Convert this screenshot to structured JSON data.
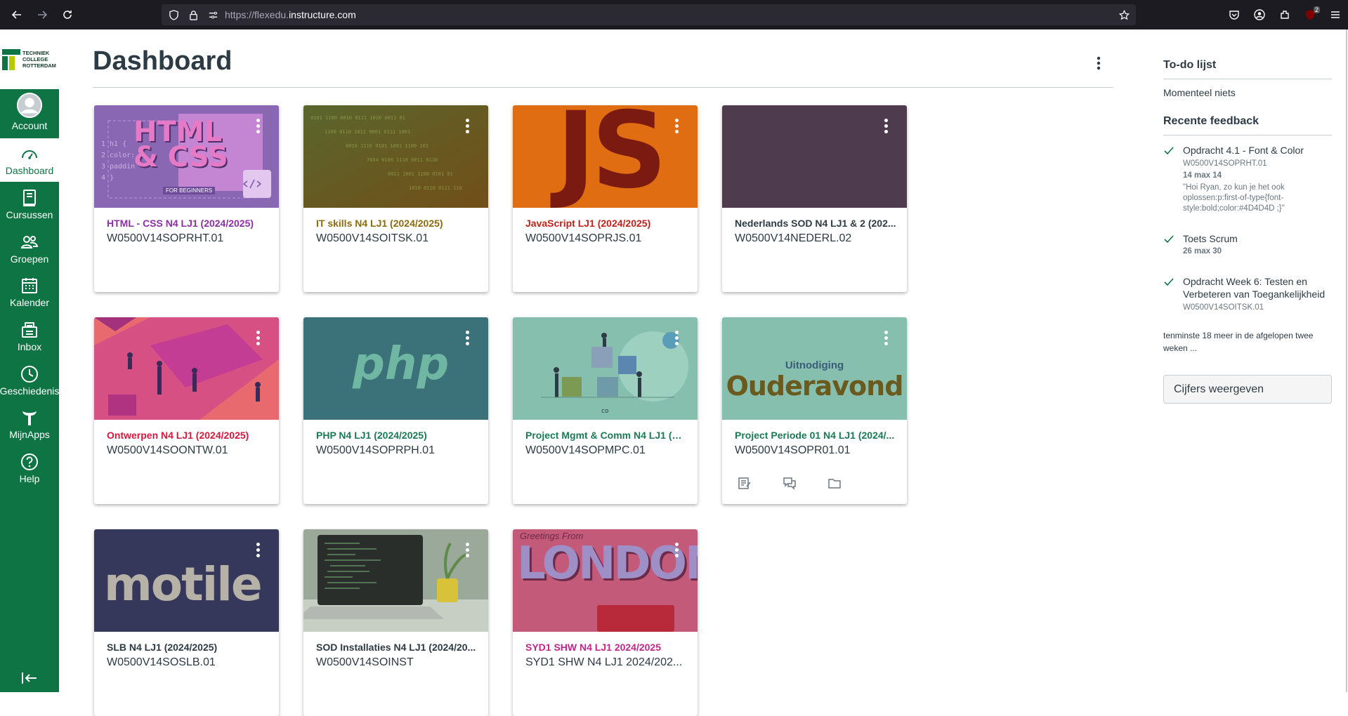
{
  "browser": {
    "url_prefix": "https://flexedu.",
    "url_domain": "instructure.com",
    "ublock_badge": "2"
  },
  "global_nav": {
    "logo_lines": [
      "TECHNIEK",
      "COLLEGE",
      "ROTTERDAM"
    ],
    "items": [
      {
        "label": "Account",
        "icon": "avatar-icon"
      },
      {
        "label": "Dashboard",
        "icon": "dashboard-icon"
      },
      {
        "label": "Cursussen",
        "icon": "courses-icon"
      },
      {
        "label": "Groepen",
        "icon": "groups-icon"
      },
      {
        "label": "Kalender",
        "icon": "calendar-icon"
      },
      {
        "label": "Inbox",
        "icon": "inbox-icon"
      },
      {
        "label": "Geschiedenis",
        "icon": "history-icon"
      },
      {
        "label": "MijnApps",
        "icon": "apps-icon"
      },
      {
        "label": "Help",
        "icon": "help-icon"
      }
    ],
    "active_color": "#0f7443"
  },
  "main": {
    "title": "Dashboard"
  },
  "cards": [
    {
      "name": "HTML - CSS N4 LJ1 (2024/2025)",
      "code": "W0500V14SOPRHT.01",
      "color": "#8b2fa3",
      "hero_text_big": "HTML\n& CSS",
      "hero_text_small": "FOR BEGINNERS"
    },
    {
      "name": "IT skills N4 LJ1 (2024/2025)",
      "code": "W0500V14SOITSK.01",
      "color": "#8b6b10"
    },
    {
      "name": "JavaScript LJ1 (2024/2025)",
      "code": "W0500V14SOPRJS.01",
      "color": "#c0221b",
      "hero_text_big": "JS"
    },
    {
      "name": "Nederlands SOD N4 LJ1 & 2 (202...",
      "code": "W0500V14NEDERL.02",
      "color": "#2d3b45"
    },
    {
      "name": "Ontwerpen N4 LJ1 (2024/2025)",
      "code": "W0500V14SOONTW.01",
      "color": "#d4183d"
    },
    {
      "name": "PHP N4 LJ1 (2024/2025)",
      "code": "W0500V14SOPRPH.01",
      "color": "#1a7a55",
      "hero_text_big": "php"
    },
    {
      "name": "Project Mgmt & Comm N4 LJ1 (20...",
      "code": "W0500V14SOPMPC.01",
      "color": "#1a7a55"
    },
    {
      "name": "Project Periode 01 N4 LJ1 (2024/...",
      "code": "W0500V14SOPR01.01",
      "color": "#1a7a55",
      "hero_text_small": "Uitnodiging",
      "hero_text_big": "Ouderavond"
    },
    {
      "name": "SLB N4 LJ1 (2024/2025)",
      "code": "W0500V14SOSLB.01",
      "color": "#2d3b45",
      "hero_text_big": "motile"
    },
    {
      "name": "SOD Installaties N4 LJ1 (2024/20...",
      "code": "W0500V14SOINST",
      "color": "#2d3b45"
    },
    {
      "name": "SYD1 SHW N4 LJ1 2024/2025",
      "code": "SYD1 SHW N4 LJ1 2024/202...",
      "color": "#c0268a",
      "hero_text_small": "Greetings From",
      "hero_text_big": "LONDON"
    }
  ],
  "sidebar": {
    "todo_title": "To-do lijst",
    "todo_empty": "Momenteel niets",
    "feedback_title": "Recente feedback",
    "feedback": [
      {
        "title": "Opdracht 4.1 - Font & Color",
        "course": "W0500V14SOPRHT.01",
        "score": "14 max 14",
        "comment": "\"Hoi Ryan, zo kun je het ook oplossen:p:first-of-type{font-style:bold;color:#4D4D4D ;}\""
      },
      {
        "title": "Toets Scrum",
        "score": "26 max 30"
      },
      {
        "title": "Opdracht Week 6: Testen en Verbeteren van Toegankelijkheid",
        "course": "W0500V14SOITSK.01"
      }
    ],
    "more_text": "tenminste 18 meer in de afgelopen twee weken ...",
    "grades_button": "Cijfers weergeven"
  }
}
